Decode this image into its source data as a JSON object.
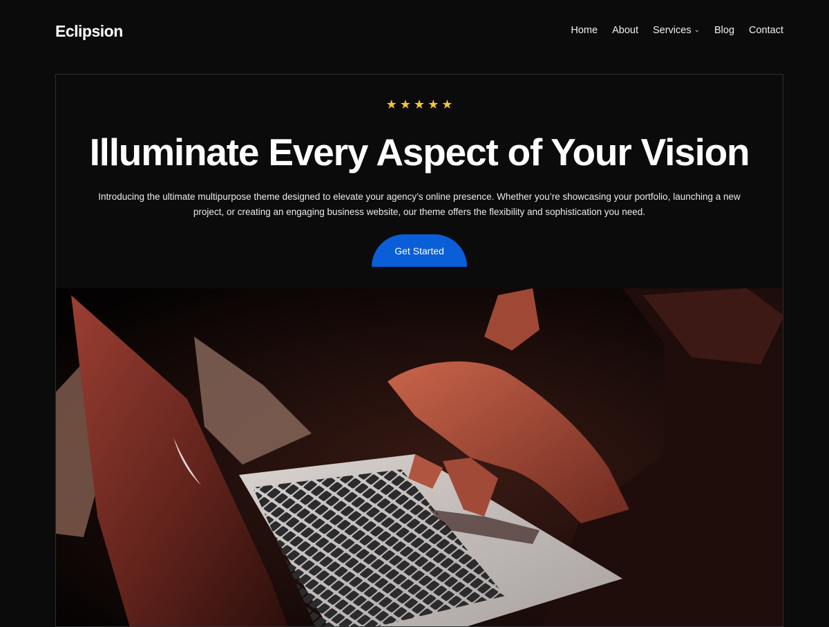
{
  "site": {
    "title": "Eclipsion"
  },
  "nav": {
    "items": [
      {
        "label": "Home"
      },
      {
        "label": "About"
      },
      {
        "label": "Services",
        "has_dropdown": true
      },
      {
        "label": "Blog"
      },
      {
        "label": "Contact"
      }
    ]
  },
  "hero": {
    "rating": 5,
    "star_icon": "star-icon",
    "star_color": "#f7c531",
    "headline": "Illuminate Every Aspect of Your Vision",
    "intro_line1": "Introducing the ultimate multipurpose theme designed to elevate your agency’s online presence. Whether you’re showcasing your portfolio, launching a new",
    "intro_line2": "project, or creating an engaging business website, our theme offers the flexibility and sophistication you need.",
    "cta_label": "Get Started",
    "cta_color": "#0a5ed7"
  },
  "colors": {
    "background": "#0b0b0b",
    "frame_border": "#2e2e2e"
  }
}
